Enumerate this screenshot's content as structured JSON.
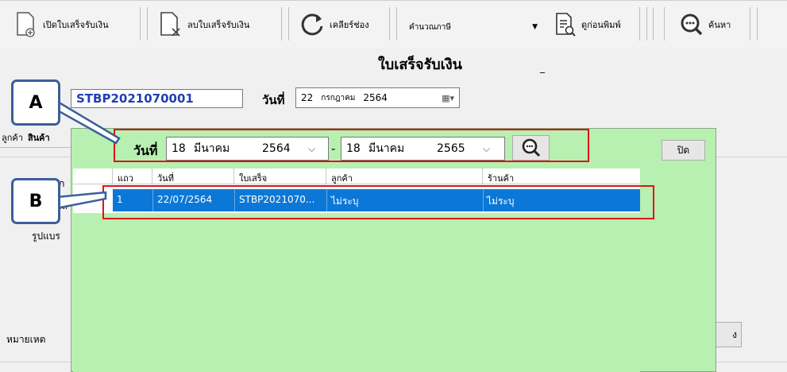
{
  "toolbar": {
    "open_label": "เปิดใบเสร็จรับเงิน",
    "delete_label": "ลบใบเสร็จรับเงิน",
    "clear_label": "เคลียร์ช่อง",
    "tax_combo_value": "คำนวณภาษี",
    "preview_label": "ดูก่อนพิมพ์",
    "search_label": "ค้นหา"
  },
  "form": {
    "title": "ใบเสร็จรับเงิน",
    "title_dash": "_",
    "doc_no": "STBP2021070001",
    "date_label": "วันที่",
    "date": {
      "day": "22",
      "month": "กรกฎาคม",
      "year": "2564"
    },
    "tabs": [
      "ลูกค้า",
      "สินค้า"
    ],
    "side_labels": [
      "เก",
      "แล",
      "รูปแบร",
      "หมายเหต"
    ],
    "right_button_label": "ง"
  },
  "popup": {
    "date_label": "วันที่",
    "from": {
      "day": "18",
      "month": "มีนาคม",
      "year": "2564"
    },
    "to": {
      "day": "18",
      "month": "มีนาคม",
      "year": "2565"
    },
    "range_dash": "-",
    "close_label": "ปิด",
    "columns": [
      "แถว",
      "วันที่",
      "ใบเสร็จ",
      "ลูกค้า",
      "ร้านค้า"
    ],
    "rows": [
      {
        "no": "1",
        "date": "22/07/2564",
        "receipt": "STBP2021070...",
        "customer": "ไม่ระบุ",
        "shop": "ไม่ระบุ"
      }
    ]
  },
  "callouts": {
    "a": "A",
    "b": "B"
  },
  "colors": {
    "popup_bg": "#b7f0b0",
    "selected_row": "#0b78d7",
    "highlight": "#e0121a",
    "callout_border": "#3a5f9a",
    "doc_no_text": "#1f3fb5"
  }
}
